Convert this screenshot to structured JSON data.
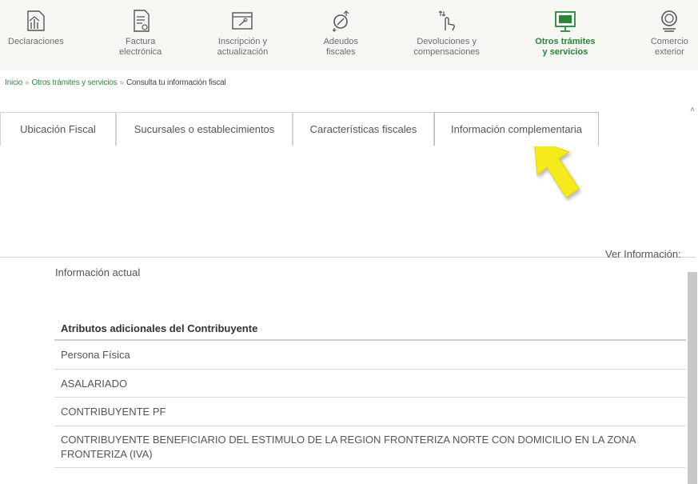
{
  "nav": {
    "items": [
      {
        "label_1": "Declaraciones",
        "label_2": "",
        "icon": "declaraciones-icon",
        "active": false
      },
      {
        "label_1": "Factura",
        "label_2": "electrónica",
        "icon": "factura-icon",
        "active": false
      },
      {
        "label_1": "Inscripción y",
        "label_2": "actualización",
        "icon": "inscripcion-icon",
        "active": false
      },
      {
        "label_1": "Adeudos",
        "label_2": "fiscales",
        "icon": "adeudos-icon",
        "active": false
      },
      {
        "label_1": "Devoluciones y",
        "label_2": "compensaciones",
        "icon": "devoluciones-icon",
        "active": false
      },
      {
        "label_1": "Otros trámites",
        "label_2": "y servicios",
        "icon": "otros-tramites-icon",
        "active": true
      },
      {
        "label_1": "Comercio",
        "label_2": "exterior",
        "icon": "comercio-exterior-icon",
        "active": false
      }
    ],
    "accent_color": "#27863a"
  },
  "breadcrumb": {
    "home": "Inicio",
    "parent": "Otros trámites y servicios",
    "current": "Consulta tu información fiscal",
    "separator": "»"
  },
  "tabs": [
    {
      "label": "Ubicación Fiscal",
      "selected": false
    },
    {
      "label": "Sucursales o establecimientos",
      "selected": false
    },
    {
      "label": "Características fiscales",
      "selected": false
    },
    {
      "label": "Información complementaria",
      "selected": true
    }
  ],
  "annotation": {
    "arrow_color": "#f5ea1e",
    "icon": "pointer-arrow-icon"
  },
  "content": {
    "ver_informacion": "Ver Información:",
    "informacion_actual": "Información actual",
    "table_header": "Atributos adicionales del Contribuyente",
    "rows": [
      "Persona Física",
      "ASALARIADO",
      "CONTRIBUYENTE PF",
      "CONTRIBUYENTE BENEFICIARIO DEL ESTIMULO DE LA REGION FRONTERIZA NORTE CON DOMICILIO EN LA ZONA FRONTERIZA (IVA)"
    ]
  }
}
